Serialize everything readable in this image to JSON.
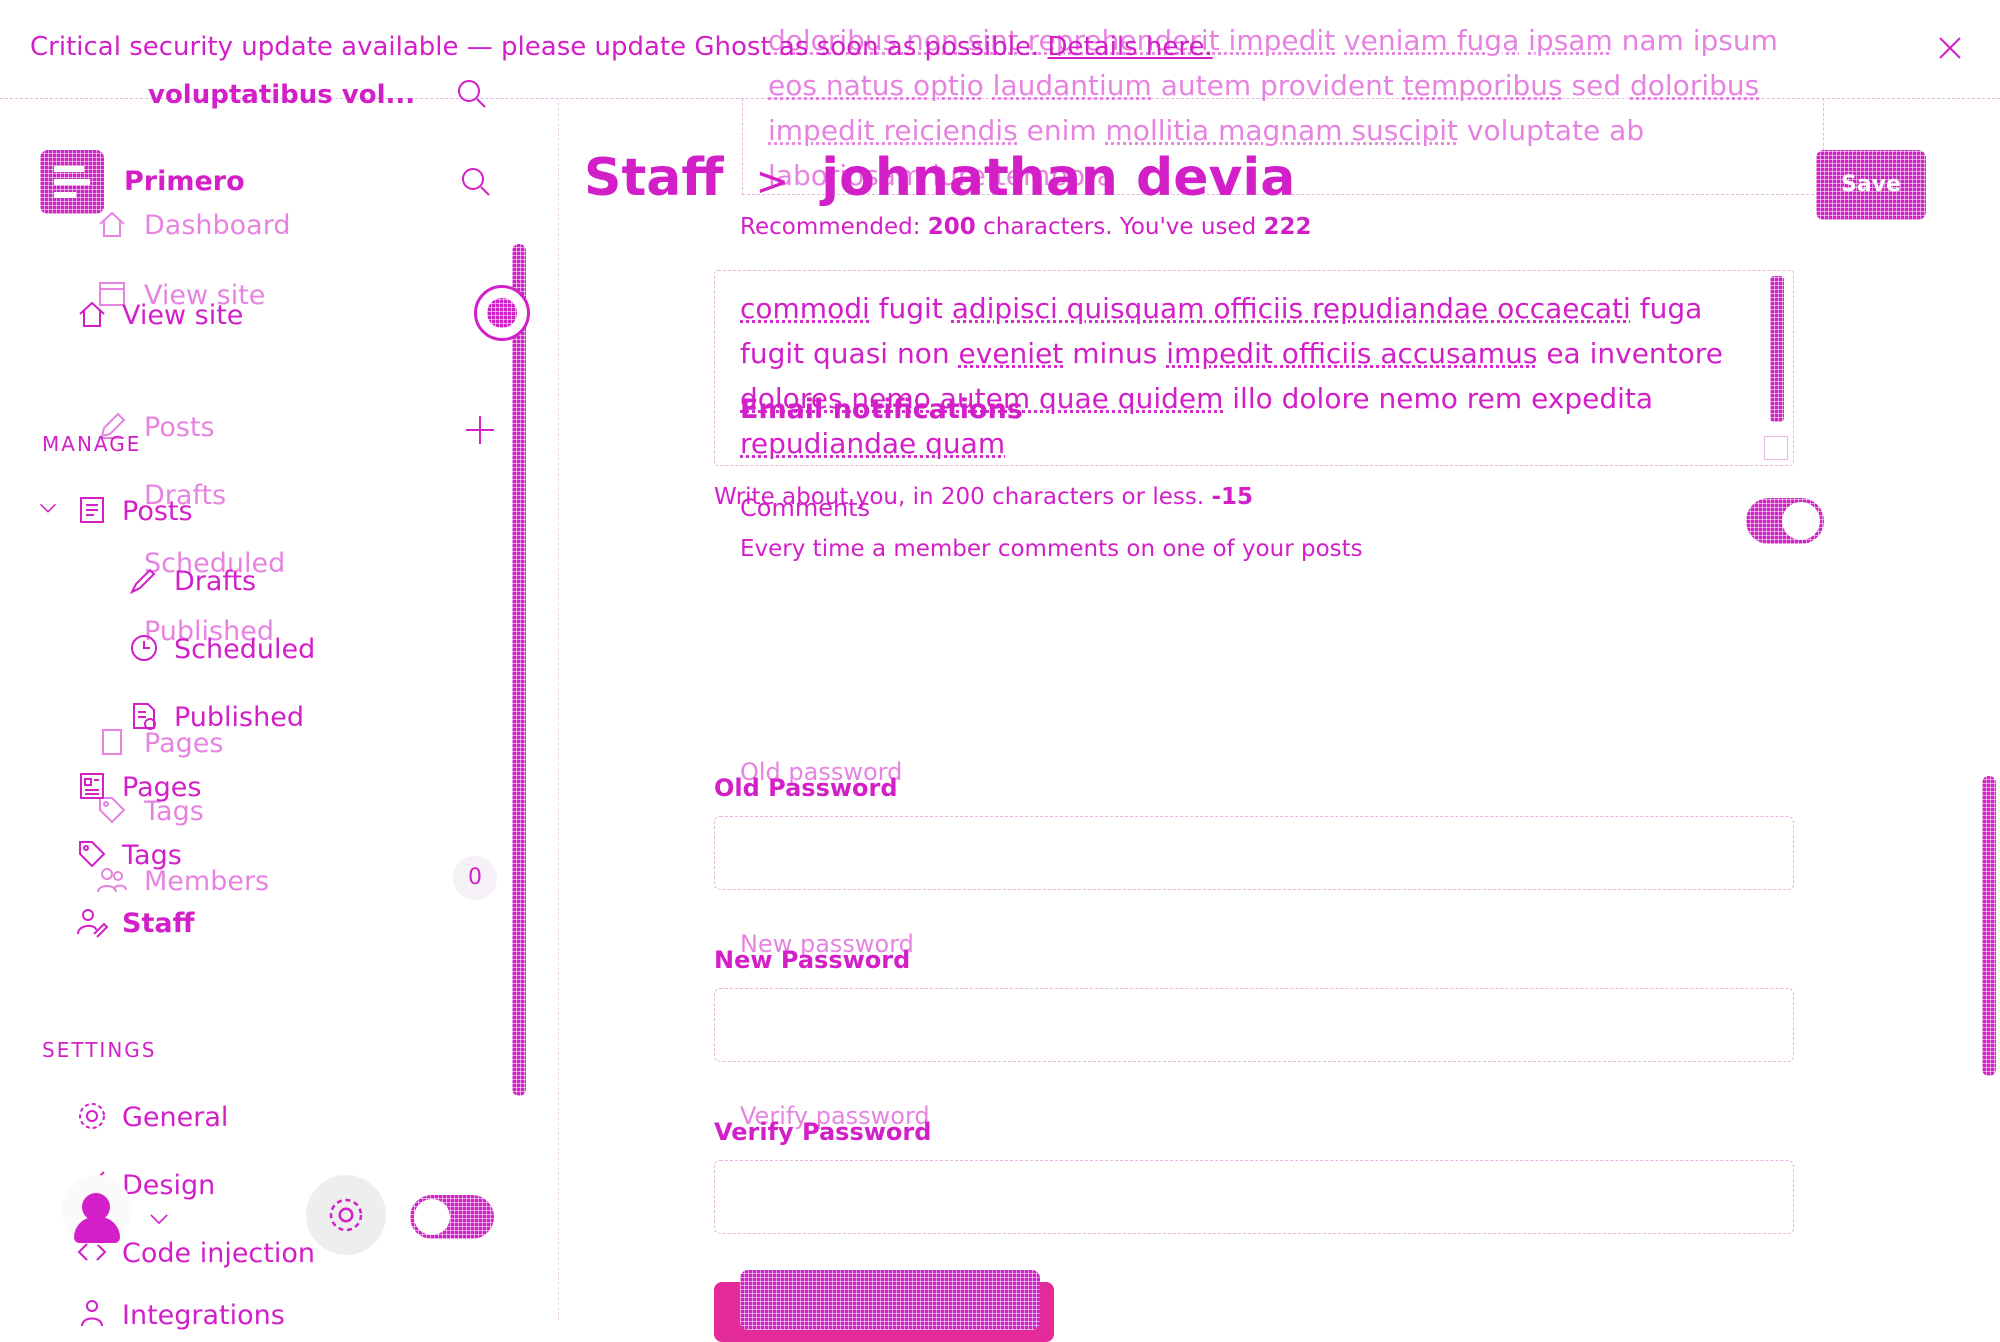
{
  "banner": {
    "message": "Critical security update available — please update Ghost as soon as possible.",
    "link": "Details here."
  },
  "site": {
    "title": "Primero",
    "name_ghost": "voluptatibus vol..."
  },
  "nav": {
    "dashboard": "Dashboard",
    "view_site": "View site",
    "manage_heading": "MANAGE",
    "posts": "Posts",
    "drafts": "Drafts",
    "scheduled": "Scheduled",
    "published": "Published",
    "pages": "Pages",
    "tags": "Tags",
    "members": "Members",
    "members_count": "0",
    "staff": "Staff",
    "settings_heading": "SETTINGS",
    "general": "General",
    "design": "Design",
    "code_injection": "Code injection",
    "integrations": "Integrations"
  },
  "header": {
    "section": "Staff",
    "separator": ">",
    "user_name": "johnathan devia",
    "save_label": "Save"
  },
  "ghost_text": {
    "line1_a": "doloribus non sint reprehenderit impedit",
    "line1_b": "veniam fuga",
    "line1_c": "ipsam",
    "line1_d": "nam ipsum",
    "line2_a": "eos natus optio",
    "line2_b": "laudantium",
    "line2_c": "autem provident",
    "line2_d": "temporibus",
    "line2_e": "sed",
    "line2_f": "doloribus",
    "line3_a": "impedit reiciendis",
    "line3_b": "enim",
    "line3_c": "mollitia magnam suscipit",
    "line3_d": "voluptate ab",
    "line4": "laboriosam iure tempora"
  },
  "recommend": {
    "prefix": "Recommended: ",
    "limit": "200",
    "middle": " characters. You've used ",
    "used": "222"
  },
  "bio": {
    "line1_a": "commodi",
    "line1_b": "fugit",
    "line1_c": "adipisci quisquam officiis repudiandae occaecati",
    "line1_d": "fuga",
    "line2_a": "fugit quasi non",
    "line2_b": "eveniet",
    "line2_c": "minus",
    "line2_d": "impedit officiis accusamus",
    "line2_e": "ea inventore",
    "line3_a": "dolores nemo autem quae quidem",
    "line3_b": "illo dolore nemo rem expedita",
    "line4": "repudiandae quam",
    "help": "Write about you, in 200 characters or less.",
    "remaining": "-15"
  },
  "notifications": {
    "heading": "Email notifications",
    "comments_title": "Comments",
    "comments_desc": "Every time a member comments on one of your posts"
  },
  "password": {
    "old_label": "Old Password",
    "old_ghost": "Old password",
    "new_label": "New Password",
    "new_ghost": "New password",
    "verify_label": "Verify Password",
    "verify_ghost": "Verify password"
  },
  "colors": {
    "accent": "#d21fc8",
    "danger": "#e0148e"
  }
}
